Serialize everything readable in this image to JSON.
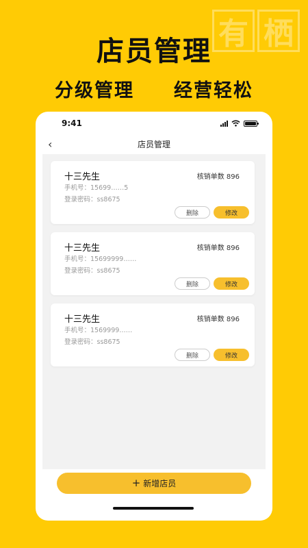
{
  "watermark": {
    "chars": [
      "有",
      "栖"
    ]
  },
  "hero": {
    "title": "店员管理",
    "sub_left": "分级管理",
    "sub_right": "经营轻松"
  },
  "status_bar": {
    "time": "9:41"
  },
  "nav": {
    "back_glyph": "‹",
    "title": "店员管理"
  },
  "staff": [
    {
      "name": "十三先生",
      "count": "核销单数 896",
      "phone": "手机号：15699……5",
      "password": "登录密码：ss8675",
      "delete_label": "删除",
      "edit_label": "修改"
    },
    {
      "name": "十三先生",
      "count": "核销单数 896",
      "phone": "手机号：15699999……",
      "password": "登录密码：ss8675",
      "delete_label": "删除",
      "edit_label": "修改"
    },
    {
      "name": "十三先生",
      "count": "核销单数 896",
      "phone": "手机号：1569999……",
      "password": "登录密码：ss8675",
      "delete_label": "删除",
      "edit_label": "修改"
    }
  ],
  "footer": {
    "add_label": "新增店员",
    "add_icon": "plus-icon"
  },
  "colors": {
    "background": "#FFCB05",
    "accent": "#F7BF2D",
    "content_bg": "#F2F2F2"
  }
}
